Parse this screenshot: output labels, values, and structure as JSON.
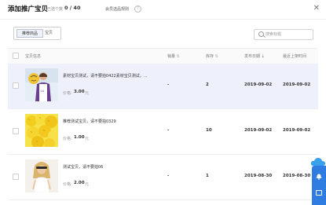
{
  "dialog": {
    "title": "添加推广宝贝",
    "selected_label": "已选个数",
    "selected_count": "0 / 40",
    "rules_link": "会员选品规则"
  },
  "tabs": [
    {
      "label": "推荐商品",
      "active": true
    },
    {
      "label": "宝贝",
      "active": false
    }
  ],
  "search": {
    "placeholder": "搜索标题",
    "value": ""
  },
  "table": {
    "columns": {
      "item": "宝贝信息",
      "sales": "销量",
      "stock": "库存",
      "publish_date": "发布日期",
      "last_listed": "最近上架时间"
    },
    "rows": [
      {
        "title": "素材宝贝测试，请不要拍0422素材宝贝测试，...",
        "price_label": "价格:",
        "price": "3.00",
        "unit": "元",
        "sales": "-",
        "stock": "2",
        "publish_date": "2019-09-02",
        "last_listed": "2019-09-02",
        "highlighted": true
      },
      {
        "title": "推荐测试宝贝，请不要拍0329",
        "price_label": "价格:",
        "price": "1.00",
        "unit": "元",
        "sales": "-",
        "stock": "10",
        "publish_date": "2019-09-02",
        "last_listed": "2019-09-02",
        "highlighted": false
      },
      {
        "title": "测试宝贝，请不要拍06",
        "price_label": "价格:",
        "price": "2.00",
        "unit": "元",
        "sales": "-",
        "stock": "1",
        "publish_date": "2019-08-30",
        "last_listed": "2019-08-30",
        "highlighted": false
      }
    ]
  },
  "colors": {
    "accent": "#2f7de1",
    "highlight_row": "#eef0fb"
  },
  "icons": [
    "help-icon",
    "close-icon",
    "search-icon",
    "sort-icon",
    "bell-icon",
    "message-icon",
    "cloud-icon"
  ]
}
